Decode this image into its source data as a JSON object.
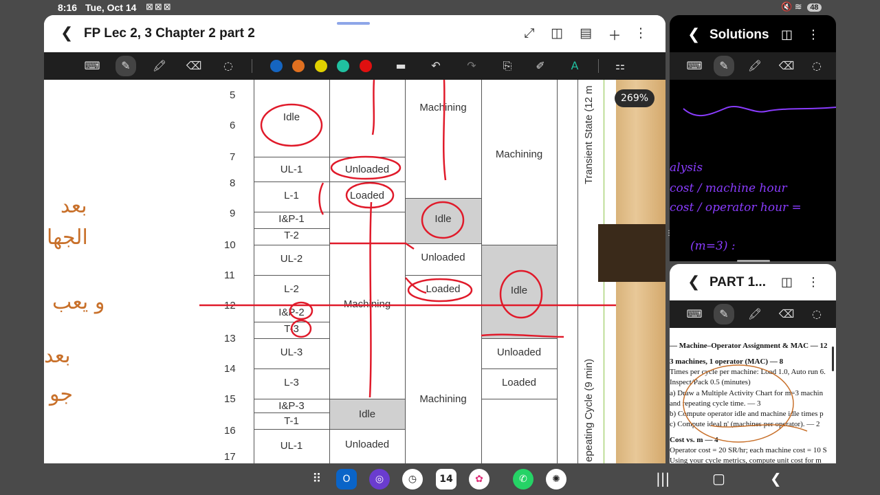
{
  "status": {
    "time": "8:16",
    "date": "Tue, Oct 14",
    "battery": "48"
  },
  "main": {
    "title": "FP Lec 2, 3 Chapter 2 part 2",
    "zoom": "269%",
    "colors": [
      "#1565c0",
      "#e07020",
      "#e0d000",
      "#20c0a0",
      "#e01010"
    ],
    "ticks": [
      "5",
      "6",
      "7",
      "8",
      "9",
      "10",
      "11",
      "12",
      "13",
      "14",
      "15",
      "16",
      "17"
    ],
    "col1": [
      "Idle",
      "UL-1",
      "L-1",
      "I&P-1",
      "T-2",
      "UL-2",
      "L-2",
      "I&P-2",
      "T-3",
      "UL-3",
      "L-3",
      "I&P-3",
      "T-1",
      "UL-1"
    ],
    "col2": [
      "Unloaded",
      "Loaded",
      "Machining",
      "Idle",
      "Unloaded"
    ],
    "col3": [
      "Machining",
      "Idle",
      "Unloaded",
      "Loaded",
      "Machining"
    ],
    "col4": [
      "Machining",
      "Idle",
      "Unloaded",
      "Loaded"
    ],
    "transient": "Transient State (12 m",
    "repeating": "epeating Cycle (9 min)"
  },
  "solutions": {
    "title": "Solutions",
    "notes": [
      "alysis",
      "cost / machine hour",
      "cost / operator hour =",
      "(m=3) :"
    ]
  },
  "part": {
    "title": "PART 1...",
    "doc": [
      "— Machine–Operator Assignment & MAC — 12",
      "3 machines, 1 operator (MAC) — 8",
      "Times per cycle per machine: Load 1.0, Auto run 6.",
      "Inspect/Pack 0.5 (minutes)",
      "a) Draw a Multiple Activity Chart for m=3 machin",
      "and repeating cycle time. — 3",
      "b) Compute operator idle and machine idle times p",
      "c) Compute ideal n' (machines per operator). — 2",
      "Cost vs. m — 4",
      "Operator cost = 20 SR/hr; each machine cost = 10 S",
      "Using your cycle metrics, compute unit cost for m"
    ]
  },
  "dock": [
    "Outlook",
    "Browser",
    "Clock",
    "14",
    "Gallery",
    "WhatsApp",
    "ChatGPT"
  ]
}
